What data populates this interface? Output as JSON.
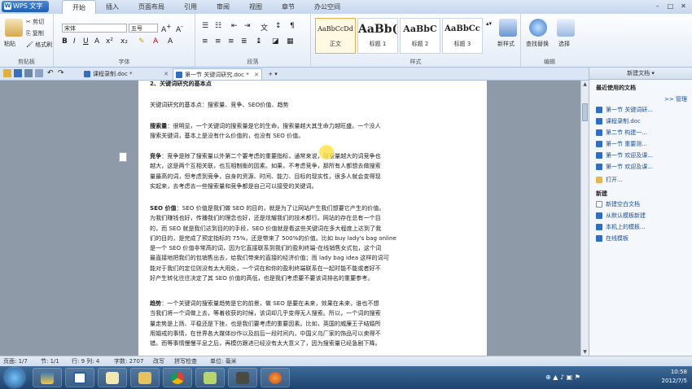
{
  "app": {
    "name": "WPS 文字"
  },
  "ribbon_tabs": [
    "开始",
    "插入",
    "页面布局",
    "引用",
    "审阅",
    "视图",
    "章节",
    "办公空间"
  ],
  "ribbon": {
    "clipboard": {
      "paste": "粘贴",
      "cut": "剪切",
      "copy": "复制",
      "format_painter": "格式刷",
      "group": "剪贴板"
    },
    "font": {
      "name": "宋体",
      "size": "五号",
      "group": "字体"
    },
    "paragraph": {
      "group": "段落"
    },
    "styles": {
      "items": [
        {
          "sample": "AaBbCcDd",
          "name": "正文"
        },
        {
          "sample": "AaBb(",
          "name": "标题 1"
        },
        {
          "sample": "AaBbC",
          "name": "标题 2"
        },
        {
          "sample": "AaBbCc",
          "name": "标题 3"
        }
      ],
      "new_style": "新样式",
      "group": "样式"
    },
    "editing": {
      "find_replace": "查找替换",
      "select": "选择",
      "group": "编辑"
    }
  },
  "doc_tabs": [
    {
      "label": "课程录制.doc *",
      "active": false
    },
    {
      "label": "第一节 关键词研究.doc *",
      "active": true
    }
  ],
  "document": {
    "heading": "2、关键词研究的基本点",
    "intro": "关键词研究的基本点：搜索量、竞争、SEO价值、趋势",
    "p1_label": "搜索量",
    "p1": "：很明显，一个关键词的搜索量是它的生命，搜索量越大其生命力越旺盛。一个没人\n搜索关键词，基本上是没有什么价值的，也没有 SEO 价值。",
    "p2_label": "竞争",
    "p2": "：竞争是除了搜索量以外第二个要考虑的重要指标，通常来说，搜索量越大的词竞争也\n越大，这是两个互相关联，也互相制衡的因素。如果，不考虑竞争，那所有人都想去做搜索\n量最高的词，但考虑到竞争，自身的资源、时间、能力、目标的现实性，很多人就会变得现\n实起来，去考虑去一些搜索量和竞争都是自己可以接受的关键词。",
    "p3_label": "SEO 价值",
    "p3": "：SEO 价值是我们做 SEO 的目的，就是为了让网站产生我们想要它产生的价值。\n为我们赚钱也好，传播我们的理念也好，还是炫耀我们的技术都行。网站的存在总有一个目\n的，而 SEO 就是我们达到目的的手段，SEO 价值就是看这些关键词在多大程度上达到了我\n们的目的，是完成了预定指标的 75%，还是带来了 500%的价值。比如 buy lady's bag online\n是一个 SEO 价值非常高的词，因为它直接联系到我们的盈利终端-在线销售女式包，这个词\n最直接地把我们的包销售出去，给我们带来的直接的经济价值；而 lady bag idea 这样的词可\n能对于我们的定位则没有太大用处，一个词在和你的盈利终端联系在一起时能不能或者好不\n好产生转化往往决定了其 SEO 价值的高低，也是我们考虑要不要该词排名的重要参考。",
    "p4_label": "趋势",
    "p4": "：一个关键词的搜索量趋势是它的前景，做 SEO 是要在未来，效果在未来，谁也不想\n当我们将一个词做上去，等着收获的时候，该词却几乎变得无人搜索。所以，一个词的搜索\n量走势是上扬、平稳还是下挫，也是我们要考虑的重要因素。比如，英国的威廉王子结婚所\n用婚戒的事情，在世界各大媒体炒作以及前后一段时间内，中国义乌厂家的饰品可以卖得不\n错。而等事情慢慢平息之后，再模仿跟进已经没有太大意义了，因为搜索量已经急剧下降。"
  },
  "task_pane": {
    "title": "新建文档 ▾",
    "recent_header": "最近使用的文档",
    "manage": ">> 管理",
    "recent": [
      "第一节 关键词研...",
      "课程录制.doc",
      "第二节 构建一...",
      "第一节 重要测...",
      "第一节 欢迎及课...",
      "第一节 欢迎及课...",
      "打开..."
    ],
    "new_header": "新建",
    "new_items": [
      "新建空白文档",
      "从默认模板新建",
      "本机上的模板...",
      "在线模板"
    ]
  },
  "status": {
    "page": "页面: 1/7",
    "section": "节: 1/1",
    "position": "行: 9 列: 4",
    "words": "字数: 2707",
    "revise": "改写",
    "spell": "拼写检查",
    "unit": "单位: 毫米"
  },
  "taskbar": {
    "time": "10:58",
    "date": "2012/7/5"
  }
}
